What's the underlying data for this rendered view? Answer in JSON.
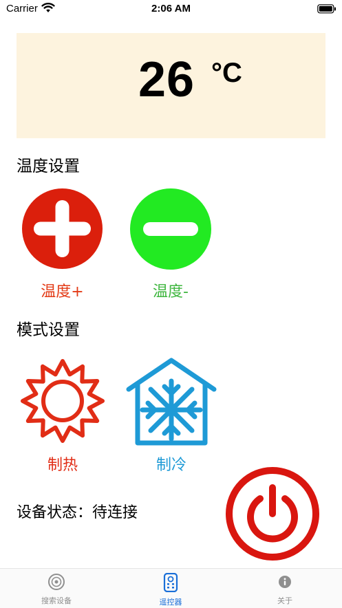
{
  "status_bar": {
    "carrier": "Carrier",
    "time": "2:06 AM"
  },
  "temperature": {
    "value": "26",
    "unit": "°C"
  },
  "temp_section": {
    "title": "温度设置",
    "increase_label": "温度+",
    "decrease_label": "温度-"
  },
  "mode_section": {
    "title": "模式设置",
    "heat_label": "制热",
    "cool_label": "制冷"
  },
  "device_status": {
    "text": "设备状态：待连接"
  },
  "tabs": [
    {
      "label": "搜索设备",
      "icon": "search-device-icon",
      "active": false
    },
    {
      "label": "遥控器",
      "icon": "remote-icon",
      "active": true
    },
    {
      "label": "关于",
      "icon": "info-icon",
      "active": false
    }
  ],
  "colors": {
    "panel_bg": "#fdf3de",
    "increase_red": "#db1f0c",
    "decrease_green": "#22ea22",
    "heat_red": "#e12d16",
    "cool_blue": "#1e9ad6",
    "tab_active": "#1a6fd8",
    "tab_inactive": "#8f8f8f"
  }
}
